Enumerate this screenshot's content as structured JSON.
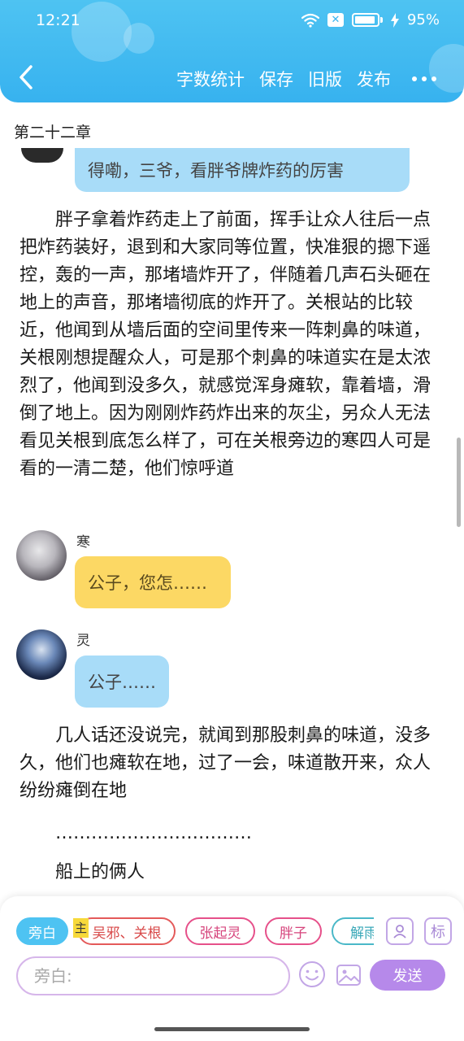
{
  "status_bar": {
    "time": "12:21",
    "battery": "95%"
  },
  "header": {
    "toolbar": {
      "word_count": "字数统计",
      "save": "保存",
      "old_version": "旧版",
      "publish": "发布"
    }
  },
  "chapter": {
    "title": "第二十二章"
  },
  "content": {
    "top_bubble": "得嘞，三爷，看胖爷牌炸药的厉害",
    "paragraph1": "胖子拿着炸药走上了前面，挥手让众人往后一点把炸药装好，退到和大家同等位置，快准狠的摁下遥控，轰的一声，那堵墙炸开了，伴随着几声石头砸在地上的声音，那堵墙彻底的炸开了。关根站的比较近，他闻到从墙后面的空间里传来一阵刺鼻的味道，关根刚想提醒众人，可是那个刺鼻的味道实在是太浓烈了，他闻到没多久，就感觉浑身瘫软，靠着墙，滑倒了地上。因为刚刚炸药炸出来的灰尘，另众人无法看见关根到底怎么样了，可在关根旁边的寒四人可是看的一清二楚，他们惊呼道",
    "messages": [
      {
        "speaker": "寒",
        "text": "公子，您怎……"
      },
      {
        "speaker": "灵",
        "text": "公子……"
      }
    ],
    "paragraph2": "几人话还没说完，就闻到那股刺鼻的味道，没多久，他们也瘫软在地，过了一会，味道散开来，众人纷纷瘫倒在地",
    "paragraph3": "……………………………",
    "paragraph4": "船上的俩人"
  },
  "composer": {
    "characters": [
      "旁白",
      "吴邪、关根",
      "张起灵",
      "胖子",
      "解雨"
    ],
    "main_badge": "主",
    "mark_label": "标",
    "input_placeholder": "旁白:",
    "send_label": "发送"
  },
  "colors": {
    "header": "#37b2ef",
    "accent_purple": "#b689ea",
    "bubble_blue": "#a8dcf8",
    "bubble_yellow": "#fcd864"
  }
}
